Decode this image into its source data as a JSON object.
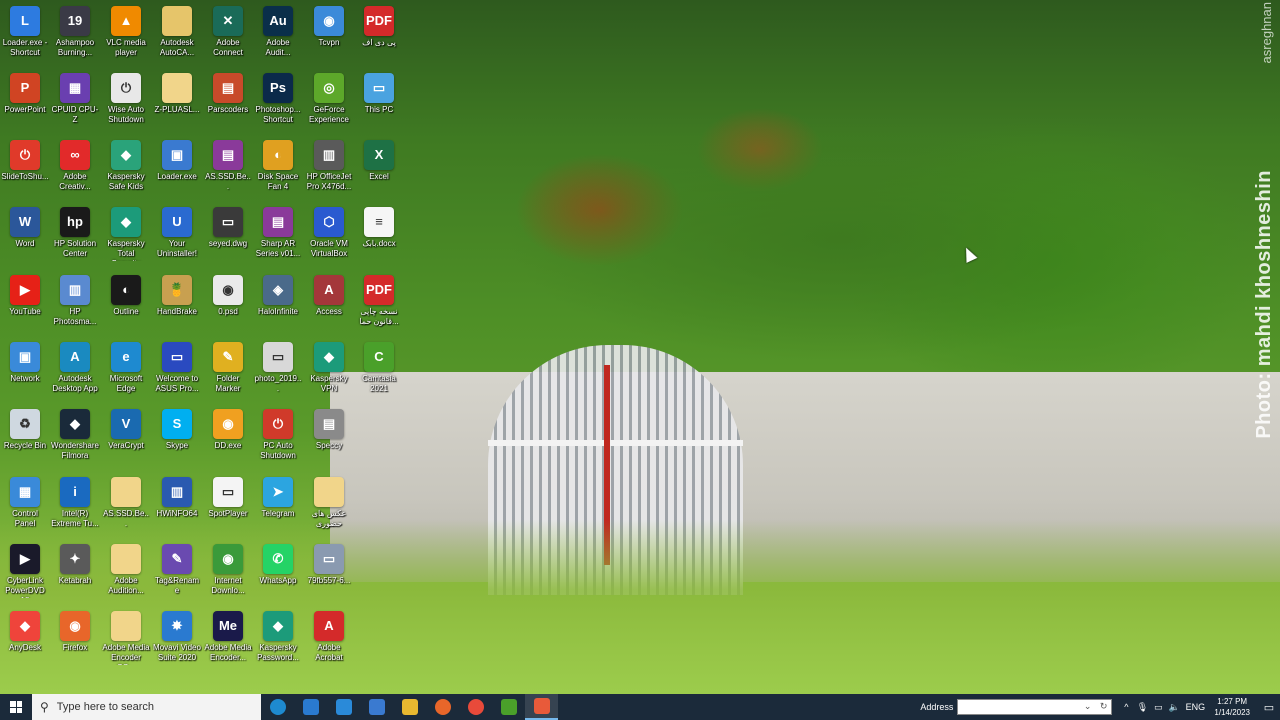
{
  "desktop": {
    "watermark": "Photo: mahdi khoshneshin",
    "watermark_top": "asreghnan",
    "icons": [
      {
        "label": "Loader.exe - Shortcut",
        "icon": "loader-icon",
        "color": "#2d7be0",
        "glyph": "L"
      },
      {
        "label": "Ashampoo Burning...",
        "icon": "ashampoo-icon",
        "color": "#3a3a46",
        "glyph": "19"
      },
      {
        "label": "VLC media player",
        "icon": "vlc-icon",
        "color": "#f08a00",
        "glyph": "▲"
      },
      {
        "label": "Autodesk AutoCA...",
        "icon": "folder-icon",
        "color": "#e6c56a",
        "glyph": ""
      },
      {
        "label": "Adobe Connect",
        "icon": "adobe-connect-icon",
        "color": "#1a6b58",
        "glyph": "✕"
      },
      {
        "label": "Adobe Audit...",
        "icon": "adobe-audition-icon",
        "color": "#0a2f4a",
        "glyph": "Au"
      },
      {
        "label": "Tcvpn",
        "icon": "tcvpn-icon",
        "color": "#3b8ad9",
        "glyph": "◉"
      },
      {
        "label": "پی دی اف",
        "icon": "pdf-icon",
        "color": "#d42a2a",
        "glyph": "PDF"
      },
      {
        "label": "PowerPoint",
        "icon": "powerpoint-icon",
        "color": "#d04423",
        "glyph": "P"
      },
      {
        "label": "CPUID CPU-Z",
        "icon": "cpuz-icon",
        "color": "#6a3fb0",
        "glyph": "▦"
      },
      {
        "label": "Wise Auto Shutdown",
        "icon": "wise-icon",
        "color": "#e8e8e8",
        "glyph": "⏻"
      },
      {
        "label": "Z-PLUASL...",
        "icon": "folder-icon",
        "color": "#f1d58a",
        "glyph": ""
      },
      {
        "label": "Parscoders",
        "icon": "parscoders-icon",
        "color": "#c84a2a",
        "glyph": "▤"
      },
      {
        "label": "Photoshop... Shortcut",
        "icon": "photoshop-icon",
        "color": "#0b2a4a",
        "glyph": "Ps"
      },
      {
        "label": "GeForce Experience",
        "icon": "geforce-icon",
        "color": "#5da82a",
        "glyph": "◎"
      },
      {
        "label": "This PC",
        "icon": "this-pc-icon",
        "color": "#4aa3e0",
        "glyph": "▭"
      },
      {
        "label": "SlideToShu...",
        "icon": "slidetoshutdown-icon",
        "color": "#e03a2a",
        "glyph": "⏻"
      },
      {
        "label": "Adobe Creativ...",
        "icon": "adobe-cc-icon",
        "color": "#e22a2a",
        "glyph": "∞"
      },
      {
        "label": "Kaspersky Safe Kids",
        "icon": "kaspersky-icon",
        "color": "#2aa37a",
        "glyph": "◆"
      },
      {
        "label": "Loader.exe",
        "icon": "loader-exe-icon",
        "color": "#3a7ad0",
        "glyph": "▣"
      },
      {
        "label": "AS.SSD.Be...",
        "icon": "winrar-icon",
        "color": "#8a3a9a",
        "glyph": "▤"
      },
      {
        "label": "Disk Space Fan 4",
        "icon": "diskspace-icon",
        "color": "#e0a020",
        "glyph": "◐"
      },
      {
        "label": "HP OfficeJet Pro X476d...",
        "icon": "printer-icon",
        "color": "#5a5a5a",
        "glyph": "▥"
      },
      {
        "label": "Excel",
        "icon": "excel-icon",
        "color": "#1e7145",
        "glyph": "X"
      },
      {
        "label": "Word",
        "icon": "word-icon",
        "color": "#2b579a",
        "glyph": "W"
      },
      {
        "label": "HP Solution Center",
        "icon": "hp-icon",
        "color": "#1a1a1a",
        "glyph": "hp"
      },
      {
        "label": "Kaspersky Total Security",
        "icon": "kaspersky-icon",
        "color": "#1c9b7a",
        "glyph": "◆"
      },
      {
        "label": "Your Uninstaller!",
        "icon": "uninstaller-icon",
        "color": "#2a6ad0",
        "glyph": "U"
      },
      {
        "label": "seyed.dwg",
        "icon": "dwg-icon",
        "color": "#3a3a3a",
        "glyph": "▭"
      },
      {
        "label": "Sharp AR Series v01...",
        "icon": "winrar-icon",
        "color": "#8a3a9a",
        "glyph": "▤"
      },
      {
        "label": "Oracle VM VirtualBox",
        "icon": "virtualbox-icon",
        "color": "#2a5ad0",
        "glyph": "⬡"
      },
      {
        "label": "بابک.docx",
        "icon": "docx-icon",
        "color": "#f6f6f6",
        "glyph": "≡"
      },
      {
        "label": "YouTube",
        "icon": "youtube-icon",
        "color": "#e62117",
        "glyph": "▶"
      },
      {
        "label": "HP Photosma...",
        "icon": "hp-photosmart-icon",
        "color": "#5a8ad0",
        "glyph": "▥"
      },
      {
        "label": "Outline",
        "icon": "outline-icon",
        "color": "#1a1a1a",
        "glyph": "◐"
      },
      {
        "label": "HandBrake",
        "icon": "handbrake-icon",
        "color": "#c8a050",
        "glyph": "🍍"
      },
      {
        "label": "0.psd",
        "icon": "psd-icon",
        "color": "#eaeaea",
        "glyph": "◉"
      },
      {
        "label": "HaloInfinite",
        "icon": "haloinfinite-icon",
        "color": "#4a6a8a",
        "glyph": "◈"
      },
      {
        "label": "Access",
        "icon": "access-icon",
        "color": "#a4373a",
        "glyph": "A"
      },
      {
        "label": "نسخه چاپی قانون حما...",
        "icon": "pdf-icon",
        "color": "#d42a2a",
        "glyph": "PDF"
      },
      {
        "label": "Network",
        "icon": "network-icon",
        "color": "#3a8ad9",
        "glyph": "▣"
      },
      {
        "label": "Autodesk Desktop App",
        "icon": "autodesk-icon",
        "color": "#1a8ac0",
        "glyph": "A"
      },
      {
        "label": "Microsoft Edge",
        "icon": "edge-icon",
        "color": "#1e8ad0",
        "glyph": "e"
      },
      {
        "label": "Welcome to ASUS Pro...",
        "icon": "asus-icon",
        "color": "#2a4ac0",
        "glyph": "▭"
      },
      {
        "label": "Folder Marker",
        "icon": "folder-marker-icon",
        "color": "#e0b020",
        "glyph": "✎"
      },
      {
        "label": "photo_2019...",
        "icon": "photo-icon",
        "color": "#d8d8d8",
        "glyph": "▭"
      },
      {
        "label": "Kaspersky VPN",
        "icon": "kaspersky-vpn-icon",
        "color": "#1c9b7a",
        "glyph": "◆"
      },
      {
        "label": "Camtasia 2021",
        "icon": "camtasia-icon",
        "color": "#4aa02a",
        "glyph": "C"
      },
      {
        "label": "Recycle Bin",
        "icon": "recycle-bin-icon",
        "color": "#cfd8e0",
        "glyph": "♻"
      },
      {
        "label": "Wondershare Filmora",
        "icon": "filmora-icon",
        "color": "#1a2a3a",
        "glyph": "◆"
      },
      {
        "label": "VeraCrypt",
        "icon": "veracrypt-icon",
        "color": "#1a6ab0",
        "glyph": "V"
      },
      {
        "label": "Skype",
        "icon": "skype-icon",
        "color": "#00aff0",
        "glyph": "S"
      },
      {
        "label": "DD.exe",
        "icon": "dd-icon",
        "color": "#f0a020",
        "glyph": "◉"
      },
      {
        "label": "PC Auto Shutdown",
        "icon": "pc-shutdown-icon",
        "color": "#d03a2a",
        "glyph": "⏻"
      },
      {
        "label": "Speccy",
        "icon": "speccy-icon",
        "color": "#8a8a8a",
        "glyph": "▤"
      },
      {
        "label": "Control Panel",
        "icon": "control-panel-icon",
        "color": "#3a8ad9",
        "glyph": "▦"
      },
      {
        "label": "Intel(R) Extreme Tu...",
        "icon": "intel-icon",
        "color": "#1a6ac0",
        "glyph": "i"
      },
      {
        "label": "AS.SSD.Be...",
        "icon": "folder-icon",
        "color": "#f1d58a",
        "glyph": ""
      },
      {
        "label": "HWiNFO64",
        "icon": "hwinfo-icon",
        "color": "#2a5ab0",
        "glyph": "▥"
      },
      {
        "label": "SpotPlayer",
        "icon": "spotplayer-icon",
        "color": "#f4f4f4",
        "glyph": "▭"
      },
      {
        "label": "Telegram",
        "icon": "telegram-icon",
        "color": "#2ca5e0",
        "glyph": "➤"
      },
      {
        "label": "عکس های حضوری",
        "icon": "folder-icon",
        "color": "#f1d58a",
        "glyph": ""
      },
      {
        "label": "CyberLink PowerDVD 18",
        "icon": "powerdvd-icon",
        "color": "#1a1a2a",
        "glyph": "▶"
      },
      {
        "label": "Ketabrah",
        "icon": "ketabrah-icon",
        "color": "#5a5a5a",
        "glyph": "✦"
      },
      {
        "label": "Adobe Audition...",
        "icon": "folder-icon",
        "color": "#f1d58a",
        "glyph": ""
      },
      {
        "label": "Tag&Rename",
        "icon": "tagrename-icon",
        "color": "#6a4ab0",
        "glyph": "✎"
      },
      {
        "label": "Internet Downlo...",
        "icon": "idm-icon",
        "color": "#3a9a3a",
        "glyph": "◉"
      },
      {
        "label": "WhatsApp",
        "icon": "whatsapp-icon",
        "color": "#25d366",
        "glyph": "✆"
      },
      {
        "label": "79fb557-6...",
        "icon": "image-file-icon",
        "color": "#8a9ab0",
        "glyph": "▭"
      },
      {
        "label": "AnyDesk",
        "icon": "anydesk-icon",
        "color": "#ef443b",
        "glyph": "◆"
      },
      {
        "label": "Firefox",
        "icon": "firefox-icon",
        "color": "#e8662a",
        "glyph": "◉"
      },
      {
        "label": "Adobe Media Encoder CC...",
        "icon": "folder-icon",
        "color": "#f1d58a",
        "glyph": ""
      },
      {
        "label": "Movavi Video Suite 2020",
        "icon": "movavi-icon",
        "color": "#2a7ad0",
        "glyph": "✸"
      },
      {
        "label": "Adobe Media Encoder...",
        "icon": "media-encoder-icon",
        "color": "#1a1a4a",
        "glyph": "Me"
      },
      {
        "label": "Kaspersky Password...",
        "icon": "kaspersky-password-icon",
        "color": "#1c9b7a",
        "glyph": "◆"
      },
      {
        "label": "Adobe Acrobat",
        "icon": "acrobat-icon",
        "color": "#d42a2a",
        "glyph": "A"
      }
    ]
  },
  "taskbar": {
    "search_placeholder": "Type here to search",
    "pinned": [
      {
        "name": "edge",
        "icon": "edge-icon",
        "color": "#1e8ad0"
      },
      {
        "name": "store",
        "icon": "store-icon",
        "color": "#2a7ad0"
      },
      {
        "name": "mail",
        "icon": "mail-icon",
        "color": "#2a8ad9"
      },
      {
        "name": "app-blue",
        "icon": "app-icon",
        "color": "#3a7ad0"
      },
      {
        "name": "file-explorer",
        "icon": "folder-icon",
        "color": "#e8b830"
      },
      {
        "name": "firefox",
        "icon": "firefox-icon",
        "color": "#e8662a"
      },
      {
        "name": "chrome",
        "icon": "chrome-icon",
        "color": "#e84a3a"
      },
      {
        "name": "camtasia",
        "icon": "camtasia-icon",
        "color": "#4aa02a"
      },
      {
        "name": "camtasia-recorder",
        "icon": "camtasia-recorder-icon",
        "color": "#e85a3a"
      }
    ],
    "address_label": "Address",
    "address_value": "",
    "language": "ENG",
    "time": "1:27 PM",
    "date": "1/14/2023"
  }
}
